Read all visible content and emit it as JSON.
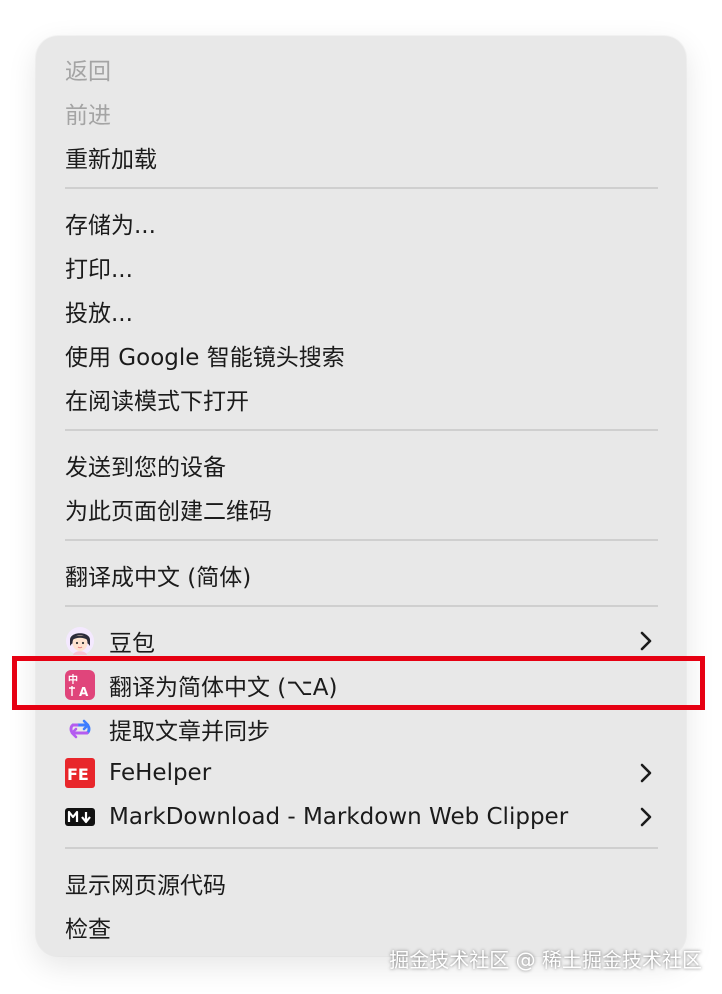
{
  "menu": {
    "back": "返回",
    "forward": "前进",
    "reload": "重新加载",
    "save_as": "存储为...",
    "print": "打印...",
    "cast": "投放...",
    "google_lens": "使用 Google 智能镜头搜索",
    "reading_mode": "在阅读模式下打开",
    "send_to_devices": "发送到您的设备",
    "qr_code": "为此页面创建二维码",
    "translate_builtin": "翻译成中文 (简体)",
    "doubao": "豆包",
    "translate_ext": "翻译为简体中文 (⌥A)",
    "extract_sync": "提取文章并同步",
    "fehelper": "FeHelper",
    "markdownload": "MarkDownload - Markdown Web Clipper",
    "view_source": "显示网页源代码",
    "inspect": "检查"
  },
  "icons": {
    "doubao": "doubao-avatar-icon",
    "translate_ext": "translate-zh-icon",
    "extract_sync": "sync-loop-icon",
    "fehelper": "fe-logo-icon",
    "markdownload": "markdown-m-arrow-icon",
    "submenu": "chevron-right-icon"
  },
  "watermark": "掘金技术社区 @ 稀土掘金技术社区",
  "colors": {
    "menu_bg": "#e8e8e8",
    "text": "#1b1b1b",
    "disabled": "#a4a4a4",
    "separator": "#cfcfcf",
    "highlight": "#e60012"
  }
}
